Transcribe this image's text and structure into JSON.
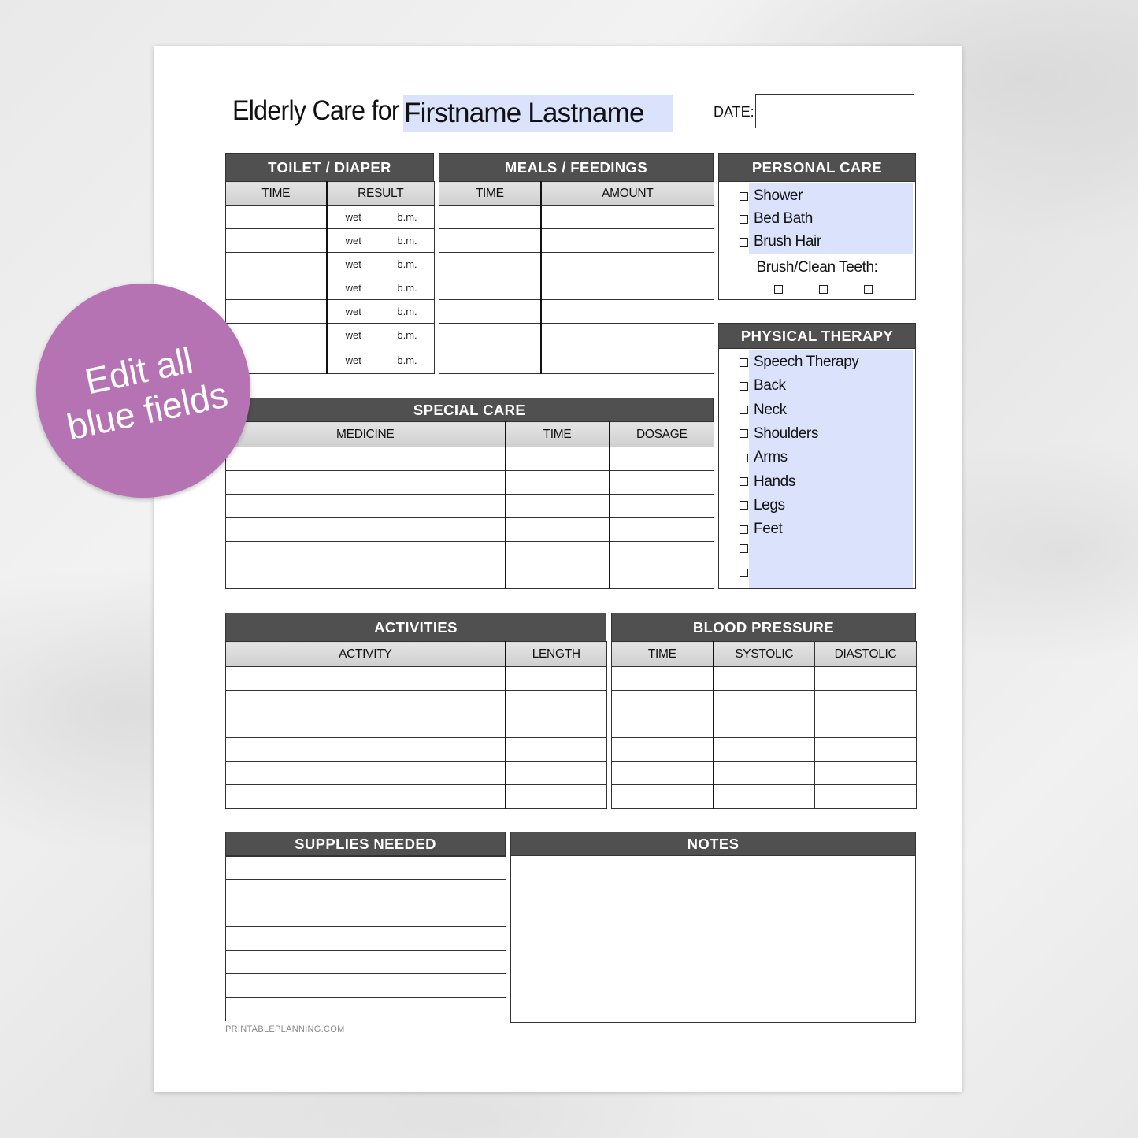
{
  "header": {
    "title_prefix": "Elderly Care for",
    "name_value": "Firstname Lastname",
    "date_label": "DATE:",
    "date_value": ""
  },
  "toilet": {
    "title": "TOILET / DIAPER",
    "columns": [
      "TIME",
      "RESULT"
    ],
    "rows": [
      {
        "time": "",
        "wet": "wet",
        "bm": "b.m."
      },
      {
        "time": "",
        "wet": "wet",
        "bm": "b.m."
      },
      {
        "time": "",
        "wet": "wet",
        "bm": "b.m."
      },
      {
        "time": "",
        "wet": "wet",
        "bm": "b.m."
      },
      {
        "time": "",
        "wet": "wet",
        "bm": "b.m."
      },
      {
        "time": "",
        "wet": "wet",
        "bm": "b.m."
      },
      {
        "time": "",
        "wet": "wet",
        "bm": "b.m."
      }
    ]
  },
  "meals": {
    "title": "MEALS / FEEDINGS",
    "columns": [
      "TIME",
      "AMOUNT"
    ],
    "row_count": 7
  },
  "personal_care": {
    "title": "PERSONAL CARE",
    "items": [
      "Shower",
      "Bed Bath",
      "Brush Hair"
    ],
    "teeth_label": "Brush/Clean Teeth:",
    "teeth_checkbox_count": 3
  },
  "physical_therapy": {
    "title": "PHYSICAL THERAPY",
    "items": [
      "Speech Therapy",
      "Back",
      "Neck",
      "Shoulders",
      "Arms",
      "Hands",
      "Legs",
      "Feet",
      "",
      ""
    ]
  },
  "special_care": {
    "title": "SPECIAL CARE",
    "columns": [
      "MEDICINE",
      "TIME",
      "DOSAGE"
    ],
    "row_count": 6
  },
  "activities": {
    "title": "ACTIVITIES",
    "columns": [
      "ACTIVITY",
      "LENGTH"
    ],
    "row_count": 6
  },
  "blood_pressure": {
    "title": "BLOOD PRESSURE",
    "columns": [
      "TIME",
      "SYSTOLIC",
      "DIASTOLIC"
    ],
    "row_count": 6
  },
  "supplies": {
    "title": "SUPPLIES NEEDED",
    "row_count": 7
  },
  "notes": {
    "title": "NOTES",
    "value": ""
  },
  "footer": {
    "site": "PRINTABLEPLANNING.COM"
  },
  "badge": {
    "line1": "Edit all",
    "line2": "blue fields"
  },
  "colors": {
    "header_bar": "#505050",
    "editable_field": "#dbe2fb",
    "badge": "#b673b4"
  }
}
